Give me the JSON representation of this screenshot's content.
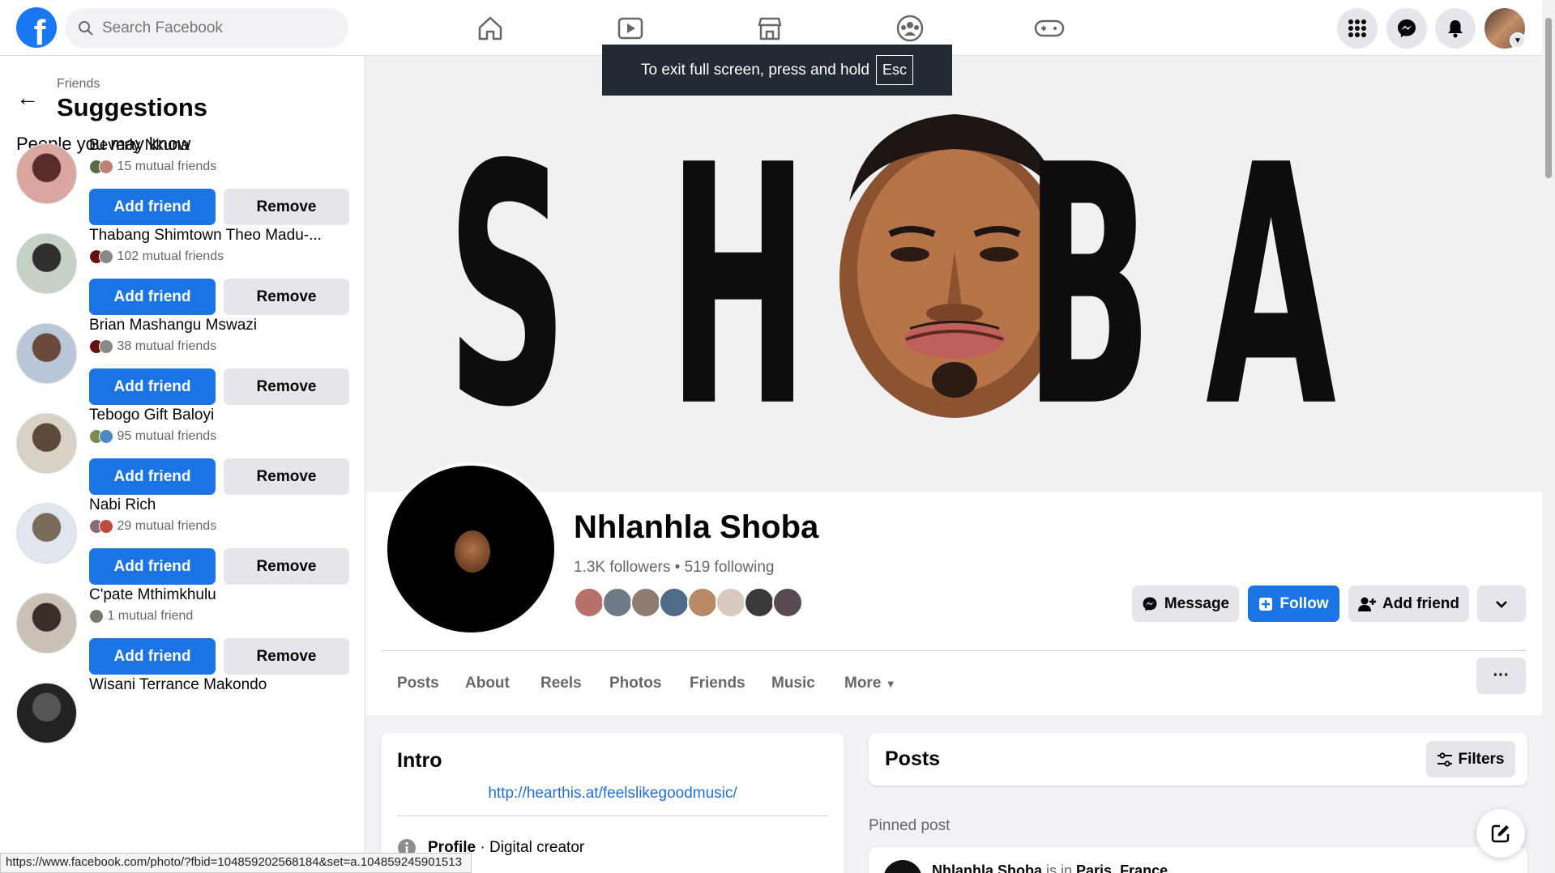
{
  "topnav": {
    "search_placeholder": "Search Facebook",
    "logo": "f",
    "brand_color": "#1877f2"
  },
  "fullscreen_toast": {
    "text": "To exit full screen, press and hold",
    "key": "Esc"
  },
  "sidebar": {
    "breadcrumb": "Friends",
    "title": "Suggestions",
    "section": "People you may know",
    "add_label": "Add friend",
    "remove_label": "Remove",
    "people": [
      {
        "name": "Beverly Nkuna",
        "mutual": "15 mutual friends"
      },
      {
        "name": "Thabang Shimtown Theo Madu-...",
        "mutual": "102 mutual friends"
      },
      {
        "name": "Brian Mashangu Mswazi",
        "mutual": "38 mutual friends"
      },
      {
        "name": "Tebogo Gift Baloyi",
        "mutual": "95 mutual friends"
      },
      {
        "name": "Nabi Rich",
        "mutual": "29 mutual friends"
      },
      {
        "name": "C'pate Mthimkhulu",
        "mutual": "1 mutual friend"
      },
      {
        "name": "Wisani Terrance Makondo",
        "mutual": ""
      }
    ]
  },
  "cover": {
    "letters": [
      "S",
      "H",
      "B",
      "A"
    ]
  },
  "profile": {
    "name": "Nhlanhla Shoba",
    "followers": "1.3K followers",
    "following": "519 following",
    "message_label": "Message",
    "follow_label": "Follow",
    "add_friend_label": "Add friend"
  },
  "tabs": [
    "Posts",
    "About",
    "Reels",
    "Photos",
    "Friends",
    "Music",
    "More"
  ],
  "intro": {
    "title": "Intro",
    "link": "http://hearthis.at/feelslikegoodmusic/",
    "profile_label": "Profile",
    "profile_value": " · Digital creator"
  },
  "posts": {
    "title": "Posts",
    "filters_label": "Filters",
    "pinned_label": "Pinned post",
    "pinned_author": "Nhlanhla Shoba",
    "pinned_is_in": " is in ",
    "pinned_place": "Paris, France"
  },
  "status_url": "https://www.facebook.com/photo/?fbid=104859202568184&set=a.104859245901513"
}
